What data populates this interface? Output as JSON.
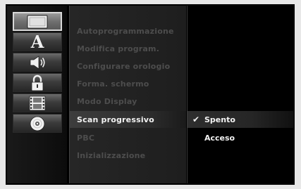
{
  "categories": [
    {
      "icon": "tv-icon",
      "selected": true
    },
    {
      "icon": "language-icon",
      "glyph": "A",
      "selected": false
    },
    {
      "icon": "speaker-icon",
      "selected": false
    },
    {
      "icon": "lock-icon",
      "selected": false
    },
    {
      "icon": "film-icon",
      "selected": false
    },
    {
      "icon": "disc-icon",
      "selected": false
    }
  ],
  "menu": {
    "items": [
      {
        "label": "Autoprogrammazione"
      },
      {
        "label": "Modifica program."
      },
      {
        "label": "Configurare orologio"
      },
      {
        "label": "Forma. schermo"
      },
      {
        "label": "Modo Display"
      },
      {
        "label": "Scan progressivo",
        "active": true
      },
      {
        "label": "PBC"
      },
      {
        "label": "Inizializzazione"
      }
    ]
  },
  "options": {
    "items": [
      {
        "label": "Spento",
        "checked": true,
        "check_glyph": "✔"
      },
      {
        "label": "Acceso",
        "checked": false
      }
    ]
  },
  "colors": {
    "active_text": "#f2f2f2",
    "disabled_text": "#4d4d4d",
    "background": "#000000"
  }
}
